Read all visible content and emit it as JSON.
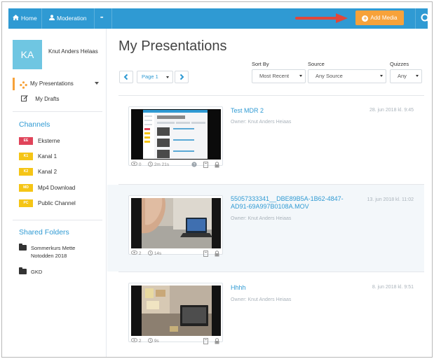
{
  "topbar": {
    "home_label": "Home",
    "moderation_label": "Moderation",
    "more_label": "•••",
    "add_media_label": "Add Media",
    "accent_color": "#2f9ad3",
    "add_media_color": "#f7a23a"
  },
  "user": {
    "initials": "KA",
    "name": "Knut Anders Helaas"
  },
  "nav": {
    "my_presentations": "My Presentations",
    "my_drafts": "My Drafts"
  },
  "channels": {
    "title": "Channels",
    "items": [
      {
        "badge": "EE",
        "label": "Eksterne",
        "color": "#e0445a"
      },
      {
        "badge": "K1",
        "label": "Kanal 1",
        "color": "#f5c516"
      },
      {
        "badge": "K2",
        "label": "Kanal 2",
        "color": "#f5c516"
      },
      {
        "badge": "MD",
        "label": "Mp4 Download",
        "color": "#f5c516"
      },
      {
        "badge": "PC",
        "label": "Public Channel",
        "color": "#f5c516"
      }
    ]
  },
  "shared_folders": {
    "title": "Shared Folders",
    "items": [
      {
        "label": "Sommerkurs Mette Notodden 2018"
      },
      {
        "label": "GKD"
      }
    ]
  },
  "main": {
    "title": "My Presentations",
    "page_select": "Page 1",
    "sort_label": "Sort By",
    "sort_value": "Most Recent",
    "source_label": "Source",
    "source_value": "Any Source",
    "quizzes_label": "Quizzes",
    "quizzes_value": "Any"
  },
  "presentations": [
    {
      "title": "Test MDR 2",
      "owner": "Owner: Knut Anders Heiaas",
      "date": "28. jun 2018 kl. 9:45",
      "views": "0",
      "duration": "2m 21s"
    },
    {
      "title": "55057333341__DBE89B5A-1B62-4847-AD91-69A997B0108A.MOV",
      "owner": "Owner: Knut Anders Heiaas",
      "date": "13. jun 2018 kl. 11:02",
      "views": "2",
      "duration": "14s"
    },
    {
      "title": "Hhhh",
      "owner": "Owner: Knut Anders Heiaas",
      "date": "8. jun 2018 kl. 9:51",
      "views": "2",
      "duration": "9s"
    }
  ]
}
